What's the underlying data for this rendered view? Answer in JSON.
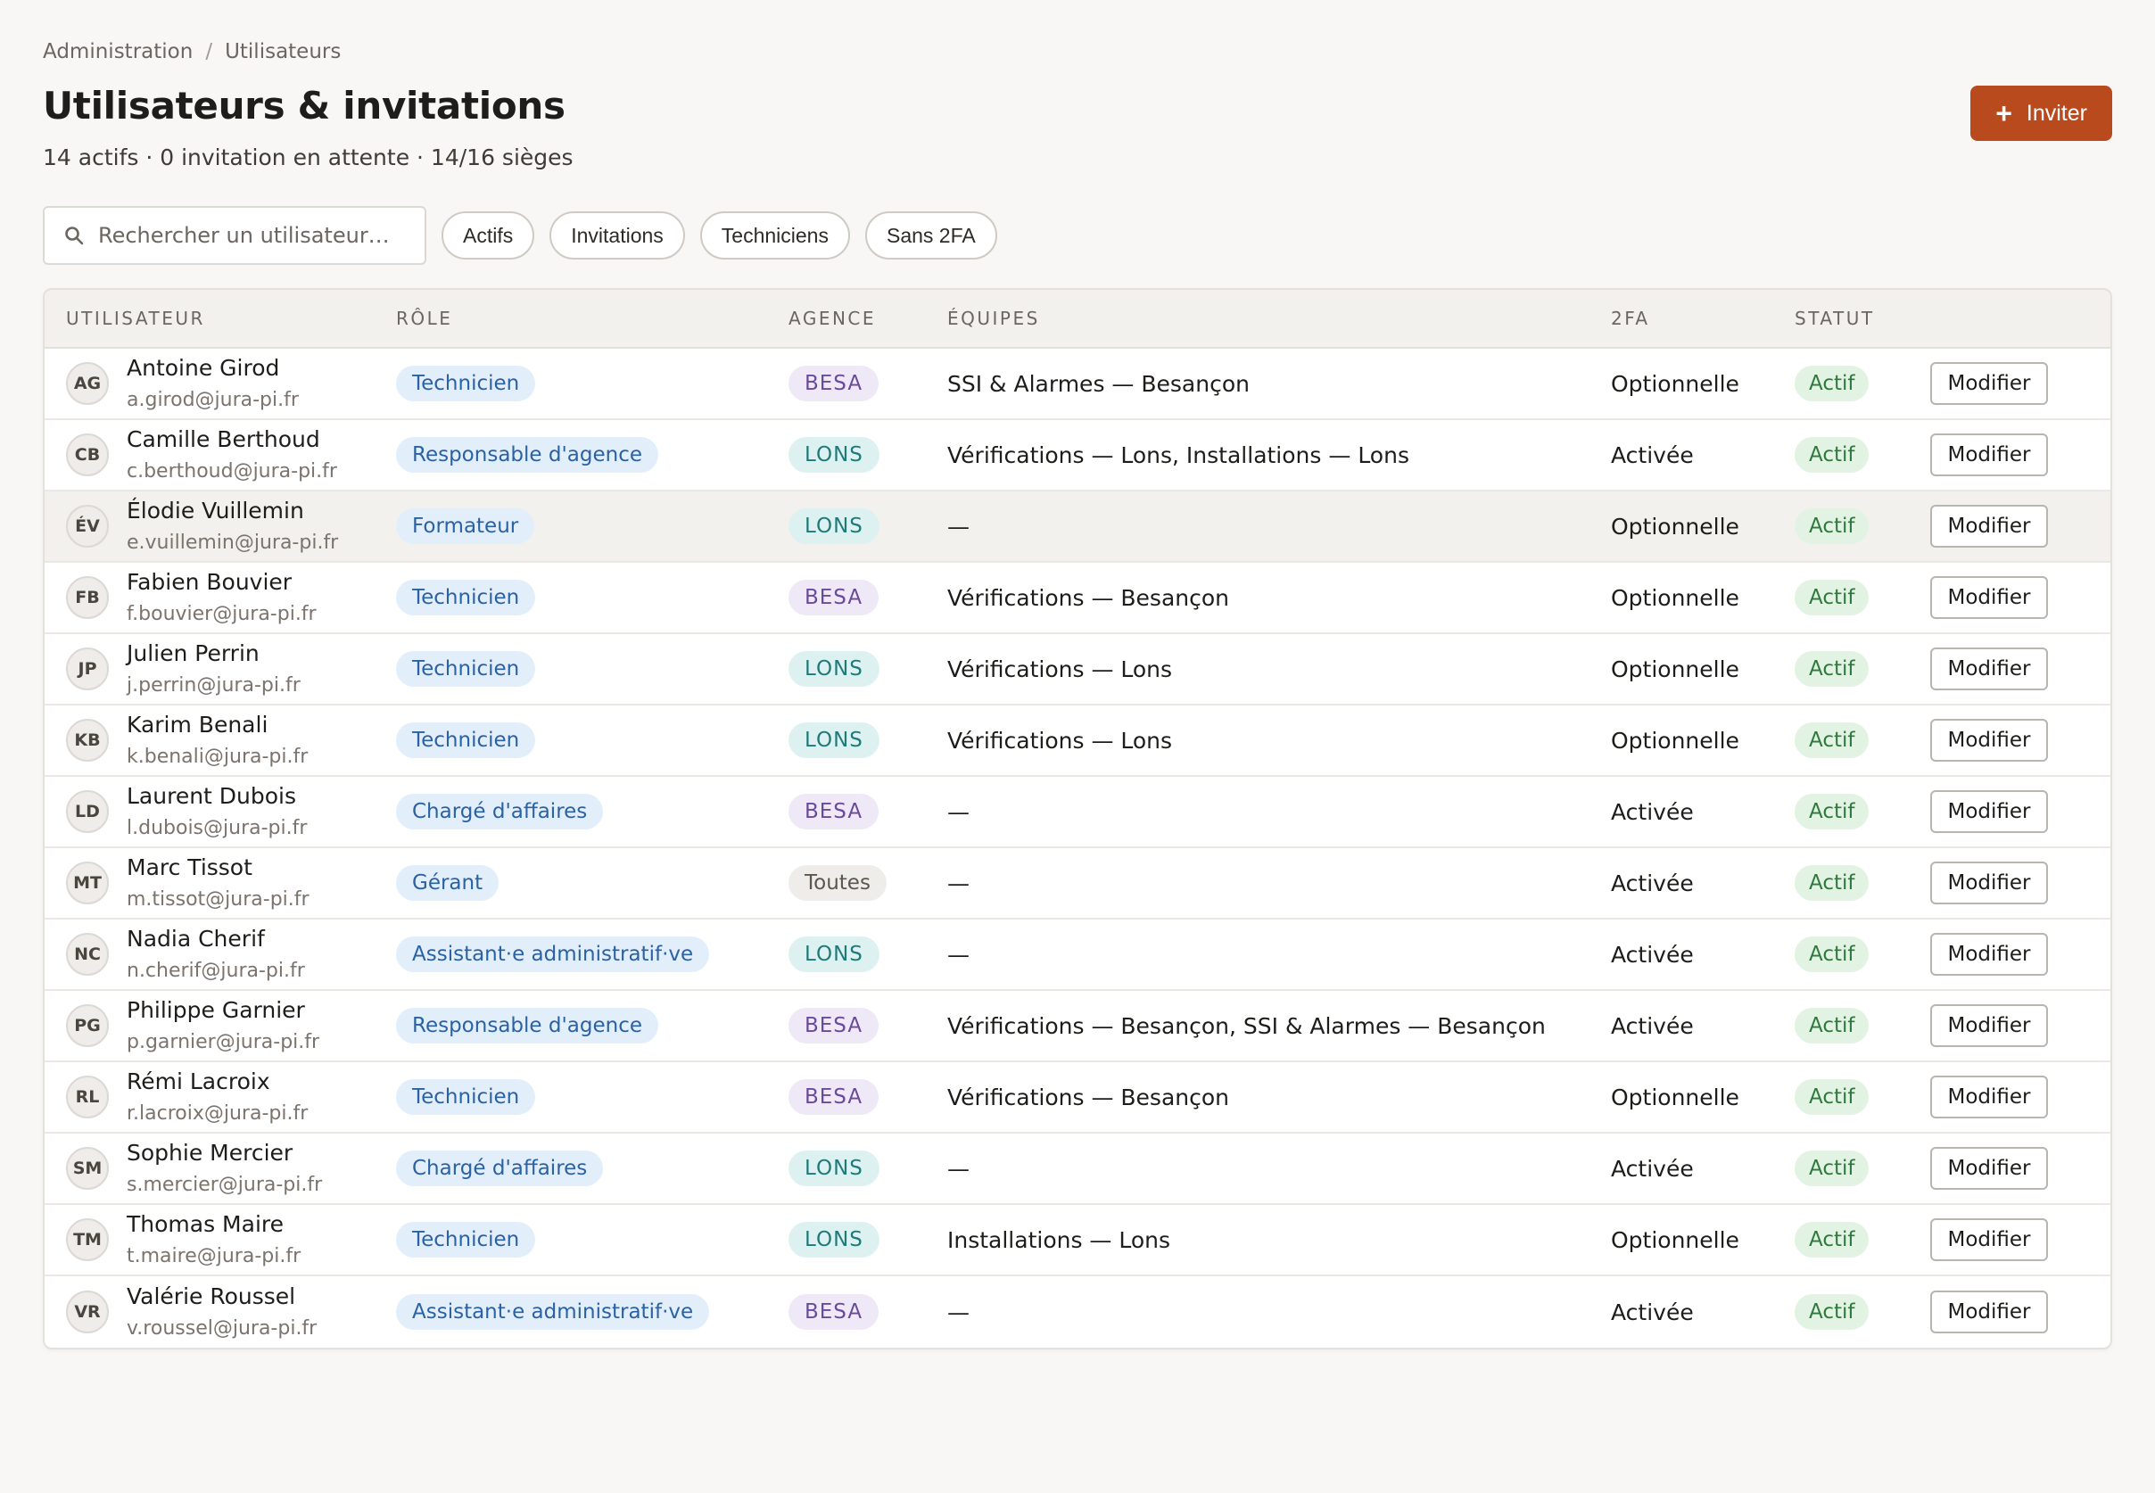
{
  "breadcrumb": {
    "parent": "Administration",
    "separator": "/",
    "current": "Utilisateurs"
  },
  "header": {
    "title": "Utilisateurs & invitations",
    "subtitle": "14 actifs · 0 invitation en attente · 14/16 sièges",
    "invite_label": "Inviter",
    "invite_icon": "plus-icon"
  },
  "filters": {
    "search_placeholder": "Rechercher un utilisateur…",
    "search_icon": "search-icon",
    "chips": [
      "Actifs",
      "Invitations",
      "Techniciens",
      "Sans 2FA"
    ]
  },
  "table": {
    "columns": [
      "Utilisateur",
      "Rôle",
      "Agence",
      "Équipes",
      "2FA",
      "Statut"
    ],
    "edit_label": "Modifier",
    "colors": {
      "accent": "#b94a1e",
      "role_badge": "#e3eefb",
      "besa": "#efe8f7",
      "lons": "#ddf1f1",
      "status": "#e2f3e4"
    },
    "rows": [
      {
        "initials": "AG",
        "name": "Antoine Girod",
        "email": "a.girod@jura-pi.fr",
        "role": "Technicien",
        "agency": "BESA",
        "teams": "SSI & Alarmes — Besançon",
        "twofa": "Optionnelle",
        "status": "Actif"
      },
      {
        "initials": "CB",
        "name": "Camille Berthoud",
        "email": "c.berthoud@jura-pi.fr",
        "role": "Responsable d'agence",
        "agency": "LONS",
        "teams": "Vérifications — Lons, Installations — Lons",
        "twofa": "Activée",
        "status": "Actif"
      },
      {
        "initials": "ÉV",
        "name": "Élodie Vuillemin",
        "email": "e.vuillemin@jura-pi.fr",
        "role": "Formateur",
        "agency": "LONS",
        "teams": "—",
        "twofa": "Optionnelle",
        "status": "Actif"
      },
      {
        "initials": "FB",
        "name": "Fabien Bouvier",
        "email": "f.bouvier@jura-pi.fr",
        "role": "Technicien",
        "agency": "BESA",
        "teams": "Vérifications — Besançon",
        "twofa": "Optionnelle",
        "status": "Actif"
      },
      {
        "initials": "JP",
        "name": "Julien Perrin",
        "email": "j.perrin@jura-pi.fr",
        "role": "Technicien",
        "agency": "LONS",
        "teams": "Vérifications — Lons",
        "twofa": "Optionnelle",
        "status": "Actif"
      },
      {
        "initials": "KB",
        "name": "Karim Benali",
        "email": "k.benali@jura-pi.fr",
        "role": "Technicien",
        "agency": "LONS",
        "teams": "Vérifications — Lons",
        "twofa": "Optionnelle",
        "status": "Actif"
      },
      {
        "initials": "LD",
        "name": "Laurent Dubois",
        "email": "l.dubois@jura-pi.fr",
        "role": "Chargé d'affaires",
        "agency": "BESA",
        "teams": "—",
        "twofa": "Activée",
        "status": "Actif"
      },
      {
        "initials": "MT",
        "name": "Marc Tissot",
        "email": "m.tissot@jura-pi.fr",
        "role": "Gérant",
        "agency": "Toutes",
        "teams": "—",
        "twofa": "Activée",
        "status": "Actif"
      },
      {
        "initials": "NC",
        "name": "Nadia Cherif",
        "email": "n.cherif@jura-pi.fr",
        "role": "Assistant·e administratif·ve",
        "agency": "LONS",
        "teams": "—",
        "twofa": "Activée",
        "status": "Actif"
      },
      {
        "initials": "PG",
        "name": "Philippe Garnier",
        "email": "p.garnier@jura-pi.fr",
        "role": "Responsable d'agence",
        "agency": "BESA",
        "teams": "Vérifications — Besançon, SSI & Alarmes — Besançon",
        "twofa": "Activée",
        "status": "Actif"
      },
      {
        "initials": "RL",
        "name": "Rémi Lacroix",
        "email": "r.lacroix@jura-pi.fr",
        "role": "Technicien",
        "agency": "BESA",
        "teams": "Vérifications — Besançon",
        "twofa": "Optionnelle",
        "status": "Actif"
      },
      {
        "initials": "SM",
        "name": "Sophie Mercier",
        "email": "s.mercier@jura-pi.fr",
        "role": "Chargé d'affaires",
        "agency": "LONS",
        "teams": "—",
        "twofa": "Activée",
        "status": "Actif"
      },
      {
        "initials": "TM",
        "name": "Thomas Maire",
        "email": "t.maire@jura-pi.fr",
        "role": "Technicien",
        "agency": "LONS",
        "teams": "Installations — Lons",
        "twofa": "Optionnelle",
        "status": "Actif"
      },
      {
        "initials": "VR",
        "name": "Valérie Roussel",
        "email": "v.roussel@jura-pi.fr",
        "role": "Assistant·e administratif·ve",
        "agency": "BESA",
        "teams": "—",
        "twofa": "Activée",
        "status": "Actif"
      }
    ]
  }
}
